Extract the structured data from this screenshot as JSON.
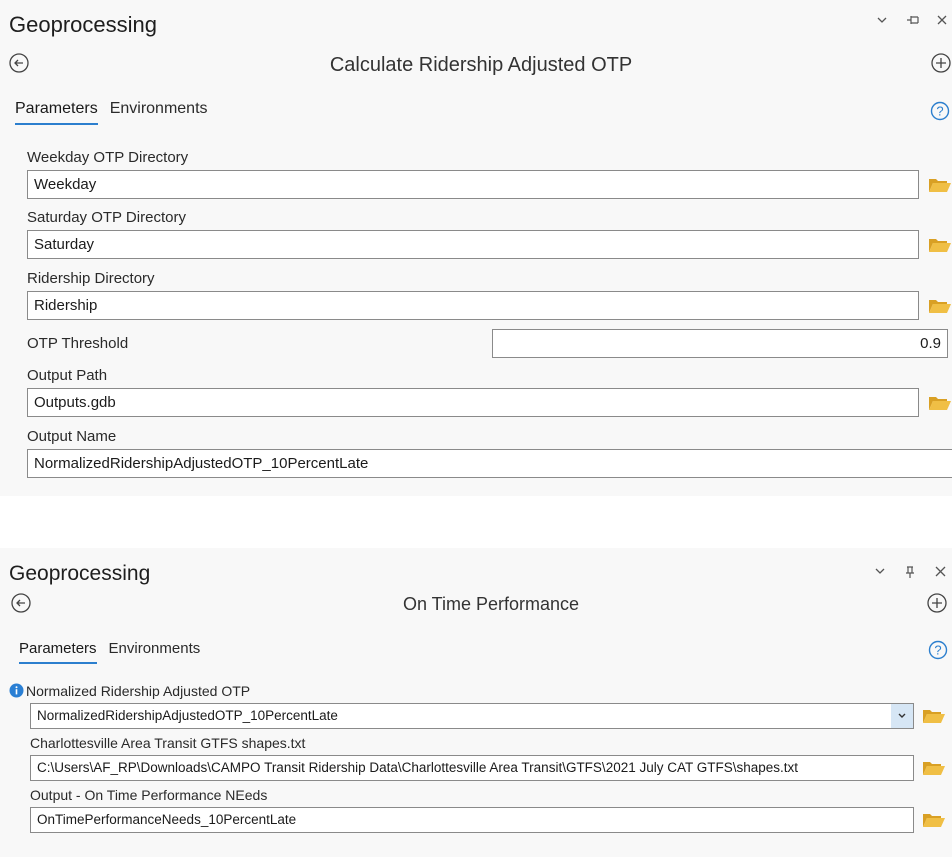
{
  "pane1": {
    "title": "Geoprocessing",
    "tool_name": "Calculate Ridership Adjusted OTP",
    "tabs": [
      "Parameters",
      "Environments"
    ],
    "params": [
      {
        "label": "Weekday OTP Directory",
        "value": "Weekday"
      },
      {
        "label": "Saturday OTP Directory",
        "value": "Saturday"
      },
      {
        "label": "Ridership Directory",
        "value": "Ridership"
      },
      {
        "label": "OTP Threshold",
        "value": "0.9"
      },
      {
        "label": "Output Path",
        "value": "Outputs.gdb"
      },
      {
        "label": "Output Name",
        "value": "NormalizedRidershipAdjustedOTP_10PercentLate"
      }
    ]
  },
  "pane2": {
    "title": "Geoprocessing",
    "tool_name": "On Time Performance",
    "tabs": [
      "Parameters",
      "Environments"
    ],
    "params": [
      {
        "label": "Normalized Ridership Adjusted OTP",
        "value": "NormalizedRidershipAdjustedOTP_10PercentLate"
      },
      {
        "label": "Charlottesville Area Transit GTFS shapes.txt",
        "value": "C:\\Users\\AF_RP\\Downloads\\CAMPO Transit Ridership Data\\Charlottesville Area Transit\\GTFS\\2021 July CAT GTFS\\shapes.txt"
      },
      {
        "label": "Output - On Time Performance NEeds",
        "value": "OnTimePerformanceNeeds_10PercentLate"
      }
    ]
  },
  "colors": {
    "accent": "#2c7fce",
    "folder": "#e8b23a",
    "info": "#2a7fd4",
    "pane_bg": "#f8f8f8"
  },
  "icons": [
    "back-arrow-icon",
    "add-icon",
    "help-icon",
    "folder-icon",
    "chevron-down-icon",
    "pin-icon",
    "close-icon",
    "info-icon"
  ]
}
